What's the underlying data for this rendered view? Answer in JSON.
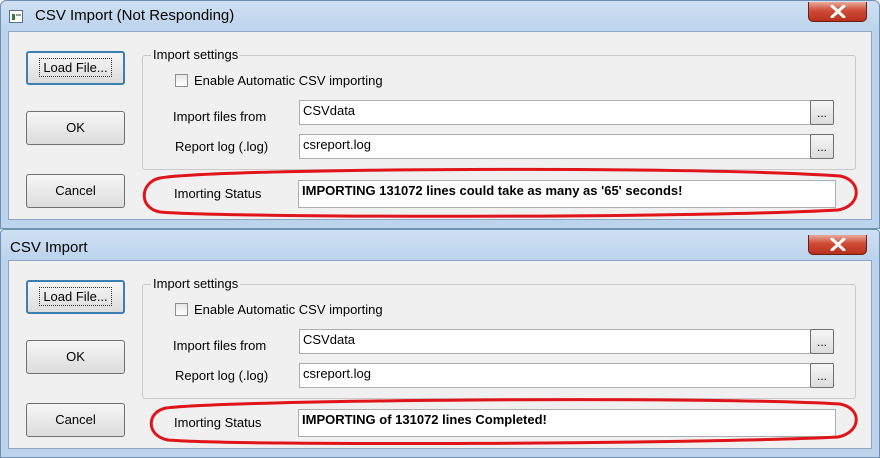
{
  "colors": {
    "annotation": "#e0151b",
    "close_button": "#c8412c",
    "default_button_border": "#3c7fb1"
  },
  "windows": [
    {
      "title": "CSV Import (Not Responding)",
      "buttons": {
        "load_file": "Load File...",
        "ok": "OK",
        "cancel": "Cancel"
      },
      "group_label": "Import settings",
      "enable_auto": {
        "label": "Enable Automatic CSV importing",
        "checked": false
      },
      "import_from": {
        "label": "Import files from",
        "value": "CSVdata",
        "browse": "..."
      },
      "report_log": {
        "label": "Report log (.log)",
        "value": "csreport.log",
        "browse": "..."
      },
      "status": {
        "label": "Imorting Status",
        "value": "IMPORTING 131072 lines could take as many as '65' seconds!"
      }
    },
    {
      "title": "CSV Import",
      "buttons": {
        "load_file": "Load File...",
        "ok": "OK",
        "cancel": "Cancel"
      },
      "group_label": "Import settings",
      "enable_auto": {
        "label": "Enable Automatic CSV importing",
        "checked": false
      },
      "import_from": {
        "label": "Import files from",
        "value": "CSVdata",
        "browse": "..."
      },
      "report_log": {
        "label": "Report log (.log)",
        "value": "csreport.log",
        "browse": "..."
      },
      "status": {
        "label": "Imorting Status",
        "value": "IMPORTING of 131072 lines Completed!"
      }
    }
  ]
}
